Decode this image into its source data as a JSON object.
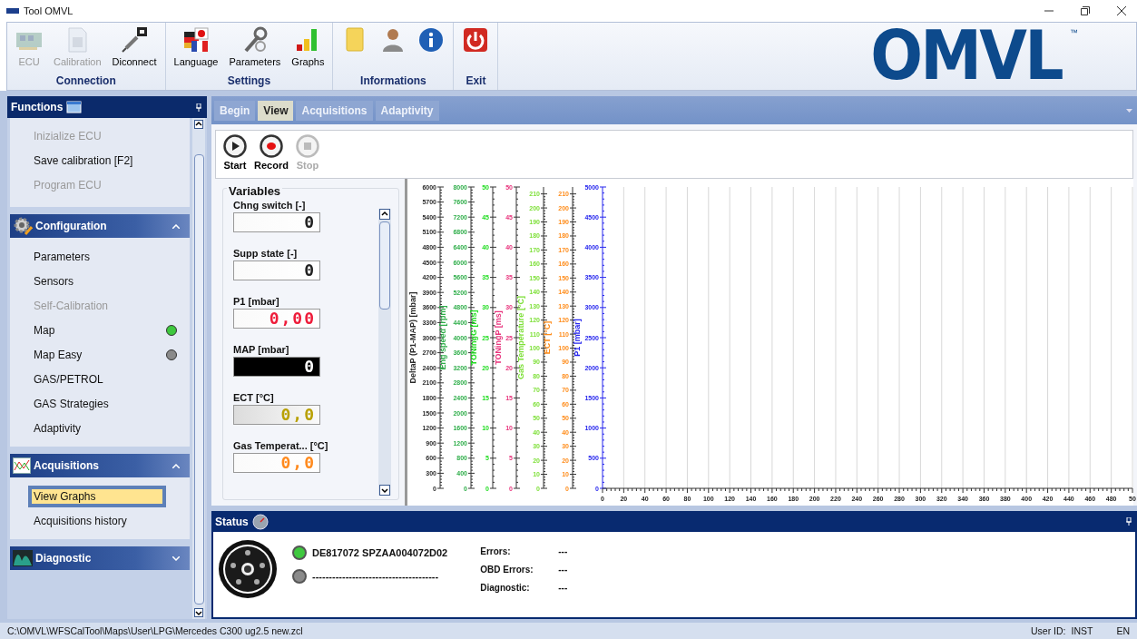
{
  "window": {
    "title": "Tool OMVL"
  },
  "ribbon": {
    "groups": [
      {
        "title": "Connection",
        "buttons": [
          {
            "label": "ECU",
            "disabled": true
          },
          {
            "label": "Calibration",
            "disabled": true
          },
          {
            "label": "Diconnect",
            "disabled": false
          }
        ]
      },
      {
        "title": "Settings",
        "buttons": [
          {
            "label": "Language",
            "disabled": false
          },
          {
            "label": "Parameters",
            "disabled": false
          },
          {
            "label": "Graphs",
            "disabled": false
          }
        ]
      },
      {
        "title": "Informations",
        "buttons": [
          {
            "disabled": false
          },
          {
            "disabled": false
          },
          {
            "disabled": false
          }
        ]
      },
      {
        "title": "Exit",
        "buttons": [
          {
            "disabled": false
          }
        ]
      }
    ],
    "logo": "OMVL",
    "logo_mark": "™"
  },
  "functions_panel": {
    "title": "Functions",
    "groups": [
      {
        "items": [
          {
            "label": "Inizialize ECU",
            "disabled": true,
            "selected": false
          },
          {
            "label": "Save calibration [F2]",
            "disabled": false,
            "selected": false
          },
          {
            "label": "Program ECU",
            "disabled": true,
            "selected": false
          }
        ]
      },
      {
        "title": "Configuration",
        "expanded": true,
        "items": [
          {
            "label": "Parameters",
            "disabled": false,
            "selected": false
          },
          {
            "label": "Sensors",
            "disabled": false,
            "selected": false
          },
          {
            "label": "Self-Calibration",
            "disabled": true,
            "selected": false
          },
          {
            "label": "Map",
            "disabled": false,
            "selected": false,
            "color": "#3ec83e"
          },
          {
            "label": "Map Easy",
            "disabled": false,
            "selected": false,
            "color": "#8a8a8a"
          },
          {
            "label": "GAS/PETROL",
            "disabled": false,
            "selected": false
          },
          {
            "label": "GAS Strategies",
            "disabled": false,
            "selected": false
          },
          {
            "label": "Adaptivity",
            "disabled": false,
            "selected": false
          }
        ]
      },
      {
        "title": "Acquisitions",
        "expanded": true,
        "items": [
          {
            "label": "View Graphs",
            "disabled": false,
            "selected": true
          },
          {
            "label": "Acquisitions history",
            "disabled": false,
            "selected": false
          }
        ]
      },
      {
        "title": "Diagnostic",
        "expanded": false
      }
    ]
  },
  "tabs": [
    {
      "label": "Begin",
      "selected": false
    },
    {
      "label": "View",
      "selected": true
    },
    {
      "label": "Acquisitions",
      "selected": false
    },
    {
      "label": "Adaptivity",
      "selected": false
    }
  ],
  "toolbar": [
    {
      "label": "Start",
      "disabled": false
    },
    {
      "label": "Record",
      "disabled": false
    },
    {
      "label": "Stop",
      "disabled": true
    }
  ],
  "variables": {
    "title": "Variables",
    "items": [
      {
        "label": "Chng switch [-]",
        "value": "0",
        "color": "#222222",
        "kind": "light"
      },
      {
        "label": "Supp state [-]",
        "value": "0",
        "color": "#222222",
        "kind": "light"
      },
      {
        "label": "P1 [mbar]",
        "value": "0,00",
        "color": "#ee1c3a",
        "kind": "light"
      },
      {
        "label": "MAP [mbar]",
        "value": "0",
        "kind": "dark"
      },
      {
        "label": "ECT [°C]",
        "value": "0,0",
        "color": "#b8a000",
        "kind": "faded"
      },
      {
        "label": "Gas Temperat... [°C]",
        "value": "0,0",
        "color": "#ff8a1e",
        "kind": "light"
      }
    ]
  },
  "graph": {
    "y_axes": [
      {
        "label": "DeltaP (P1-MAP) [mbar]",
        "color": "#2a2a2a",
        "ticks": [
          "6000",
          "5700",
          "5400",
          "5100",
          "4800",
          "4500",
          "4200",
          "3900",
          "3600",
          "3300",
          "3000",
          "2700",
          "2400",
          "2100",
          "1800",
          "1500",
          "1200",
          "900",
          "600",
          "300",
          "0"
        ]
      },
      {
        "label": "Eng speed [rpm]",
        "color": "#2fae4a",
        "ticks": [
          "8000",
          "7600",
          "7200",
          "6800",
          "6400",
          "6000",
          "5600",
          "5200",
          "4800",
          "4400",
          "4000",
          "3600",
          "3200",
          "2800",
          "2400",
          "2000",
          "1600",
          "1200",
          "800",
          "400",
          "0"
        ]
      },
      {
        "label": "TONingG [ms]",
        "color": "#22dd22",
        "ticks": [
          "50",
          "45",
          "40",
          "35",
          "30",
          "25",
          "20",
          "15",
          "10",
          "5",
          "0"
        ]
      },
      {
        "label": "TONingP [ms]",
        "color": "#e8337c",
        "ticks": [
          "50",
          "45",
          "40",
          "35",
          "30",
          "25",
          "20",
          "15",
          "10",
          "5",
          "0"
        ]
      },
      {
        "label": "Gas Temperature [°C]",
        "color": "#7fe03a",
        "ticks": [
          "210",
          "200",
          "190",
          "180",
          "170",
          "160",
          "150",
          "140",
          "130",
          "120",
          "110",
          "100",
          "90",
          "80",
          "70",
          "60",
          "50",
          "40",
          "30",
          "20",
          "10",
          "0"
        ]
      },
      {
        "label": "ECT [°C]",
        "color": "#ff8c1a",
        "ticks": [
          "210",
          "200",
          "190",
          "180",
          "170",
          "160",
          "150",
          "140",
          "130",
          "120",
          "110",
          "100",
          "90",
          "80",
          "70",
          "60",
          "50",
          "40",
          "30",
          "20",
          "10",
          "0"
        ]
      },
      {
        "label": "P1 [mbar]",
        "color": "#2525ee",
        "ticks": [
          "5000",
          "4500",
          "4000",
          "3500",
          "3000",
          "2500",
          "2000",
          "1500",
          "1000",
          "500",
          "0"
        ]
      }
    ],
    "x_ticks": [
      "0",
      "20",
      "40",
      "60",
      "80",
      "100",
      "120",
      "140",
      "160",
      "180",
      "200",
      "220",
      "240",
      "260",
      "280",
      "300",
      "320",
      "340",
      "360",
      "380",
      "400",
      "420",
      "440",
      "460",
      "480",
      "50"
    ]
  },
  "status": {
    "title": "Status",
    "devices": [
      {
        "text": "DE817072 SPZAA004072D02",
        "color": "#3ec83e"
      },
      {
        "text": "--------------------------------------",
        "color": "#8a8a8a"
      }
    ],
    "fields": [
      {
        "label": "Errors:",
        "value": "---"
      },
      {
        "label": "OBD Errors:",
        "value": "---"
      },
      {
        "label": "Diagnostic:",
        "value": "---"
      }
    ]
  },
  "status_bar": {
    "path": "C:\\OMVL\\WFSCalTool\\Maps\\User\\LPG\\Mercedes C300 ug2.5 new.zcl",
    "user_label": "User ID:",
    "user": "INST",
    "language": "EN"
  }
}
